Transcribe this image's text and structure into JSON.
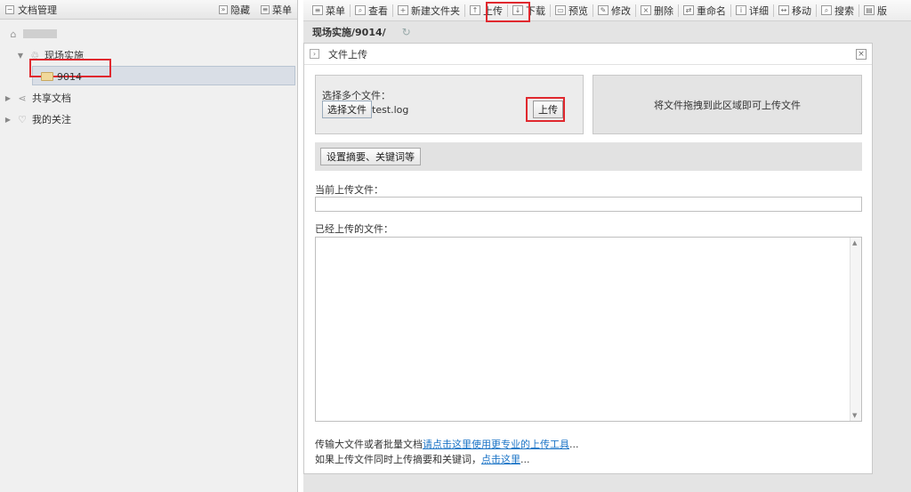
{
  "left_panel": {
    "title": "文档管理",
    "hide_label": "隐藏",
    "menu_label": "菜单",
    "tree": {
      "group_label": "现场实施",
      "selected_folder": "9014",
      "shared_label": "共享文档",
      "favorites_label": "我的关注"
    }
  },
  "toolbar": {
    "items": [
      {
        "label": "菜单",
        "icon": "menu-icon"
      },
      {
        "label": "查看",
        "icon": "view-icon"
      },
      {
        "label": "新建文件夹",
        "icon": "new-folder-icon"
      },
      {
        "label": "上传",
        "icon": "upload-icon"
      },
      {
        "label": "下载",
        "icon": "download-icon"
      },
      {
        "label": "预览",
        "icon": "preview-icon"
      },
      {
        "label": "修改",
        "icon": "edit-icon"
      },
      {
        "label": "删除",
        "icon": "delete-icon"
      },
      {
        "label": "重命名",
        "icon": "rename-icon"
      },
      {
        "label": "详细",
        "icon": "detail-icon"
      },
      {
        "label": "移动",
        "icon": "move-icon"
      },
      {
        "label": "搜索",
        "icon": "search-icon"
      },
      {
        "label": "版",
        "icon": "version-icon"
      }
    ]
  },
  "path": "现场实施/9014/",
  "dialog": {
    "title": "文件上传",
    "select_label": "选择多个文件：",
    "choose_button": "选择文件",
    "file_name": "test.log",
    "upload_button": "上传",
    "drop_hint": "将文件拖拽到此区域即可上传文件",
    "meta_button": "设置摘要、关键词等",
    "current_label": "当前上传文件：",
    "current_value": "",
    "uploaded_label": "已经上传的文件：",
    "footer": {
      "line1_prefix": "传输大文件或者批量文档",
      "line1_link": "请点击这里使用更专业的上传工具",
      "line1_suffix": "...",
      "line2_prefix": "如果上传文件同时上传摘要和关键词，",
      "line2_link": "点击这里",
      "line2_suffix": "..."
    }
  },
  "colors": {
    "highlight": "#e0282e",
    "link": "#1a73c6"
  }
}
